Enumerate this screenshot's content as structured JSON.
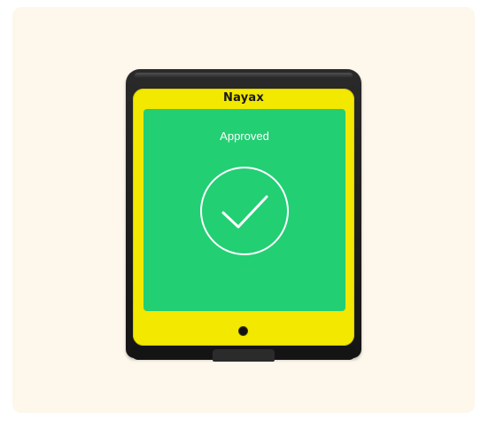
{
  "device": {
    "brand_label": "Nayax",
    "status_text": "Approved",
    "status_icon": "check-circle-icon",
    "colors": {
      "background_card": "#fdf7ec",
      "bezel": "#f2e800",
      "screen": "#22cf73",
      "housing": "#1c1c1c"
    }
  }
}
